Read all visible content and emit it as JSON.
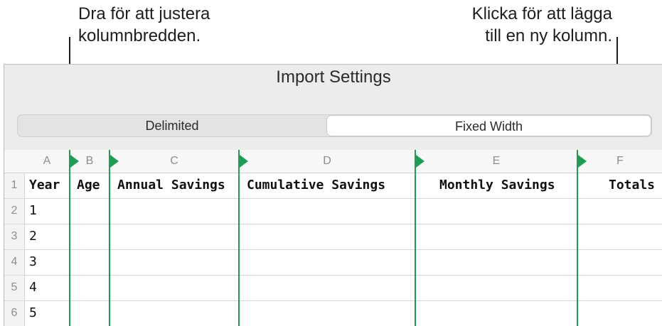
{
  "callouts": {
    "left": [
      "Dra för att justera",
      "kolumnbredden."
    ],
    "right": [
      "Klicka för att lägga",
      "till en ny kolumn."
    ]
  },
  "dialog": {
    "title": "Import Settings",
    "segments": {
      "delimited": "Delimited",
      "fixed_width": "Fixed Width",
      "selected": "Fixed Width"
    }
  },
  "table": {
    "column_letters": [
      "A",
      "B",
      "C",
      "D",
      "E",
      "F"
    ],
    "row_numbers": [
      "1",
      "2",
      "3",
      "4",
      "5",
      "6"
    ],
    "header_row": [
      "Year",
      "Age",
      "Annual Savings",
      "Cumulative Savings",
      "Monthly Savings",
      "Totals"
    ],
    "year_values": [
      "1",
      "2",
      "3",
      "4",
      "5"
    ]
  },
  "colors": {
    "divider": "#1f9d55"
  }
}
